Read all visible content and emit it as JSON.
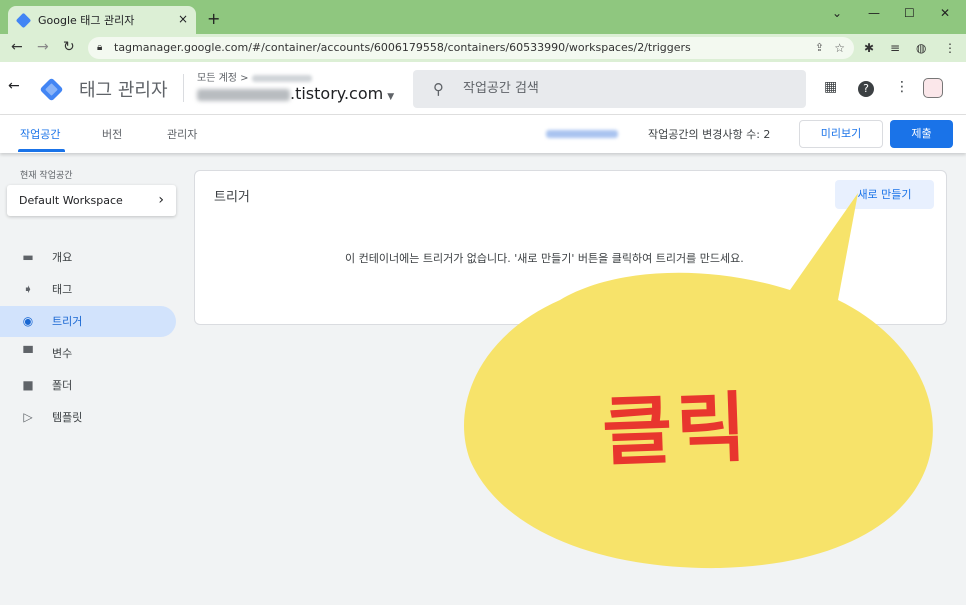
{
  "browser": {
    "tab_title": "Google 태그 관리자",
    "tab_close": "×",
    "new_tab": "+",
    "url": "tagmanager.google.com/#/container/accounts/6006179558/containers/60533990/workspaces/2/triggers",
    "nav": {
      "back": "←",
      "forward": "→",
      "reload": "↻"
    },
    "window": {
      "chevron": "⌄",
      "minimize": "—",
      "maximize": "☐",
      "close": "✕"
    }
  },
  "header": {
    "back": "←",
    "app_name": "태그 관리자",
    "account_label": "모든 계정 >",
    "container_name_suffix": ".tistory.com",
    "search_placeholder": "작업공간 검색",
    "icons": {
      "apps": "▦",
      "help": "?",
      "more": "⋮"
    }
  },
  "nav": {
    "tabs": [
      {
        "label": "작업공간",
        "active": true
      },
      {
        "label": "버전",
        "active": false
      },
      {
        "label": "관리자",
        "active": false
      }
    ],
    "changes_text": "작업공간의 변경사항 수: 2",
    "preview_label": "미리보기",
    "submit_label": "제출"
  },
  "sidebar": {
    "current_workspace_label": "현재 작업공간",
    "workspace_name": "Default Workspace",
    "items": [
      {
        "label": "개요",
        "icon": "overview-icon",
        "active": false
      },
      {
        "label": "태그",
        "icon": "tag-icon",
        "active": false
      },
      {
        "label": "트리거",
        "icon": "trigger-icon",
        "active": true
      },
      {
        "label": "변수",
        "icon": "variable-icon",
        "active": false
      },
      {
        "label": "폴더",
        "icon": "folder-icon",
        "active": false
      },
      {
        "label": "템플릿",
        "icon": "template-icon",
        "active": false
      }
    ]
  },
  "main": {
    "card_title": "트리거",
    "new_button_label": "새로 만들기",
    "empty_message": "이 컨테이너에는 트리거가 없습니다. '새로 만들기' 버튼을 클릭하여 트리거를 만드세요."
  },
  "annotation": {
    "text": "클릭",
    "bubble_color": "#f7e36a",
    "text_color": "#e8362e"
  }
}
